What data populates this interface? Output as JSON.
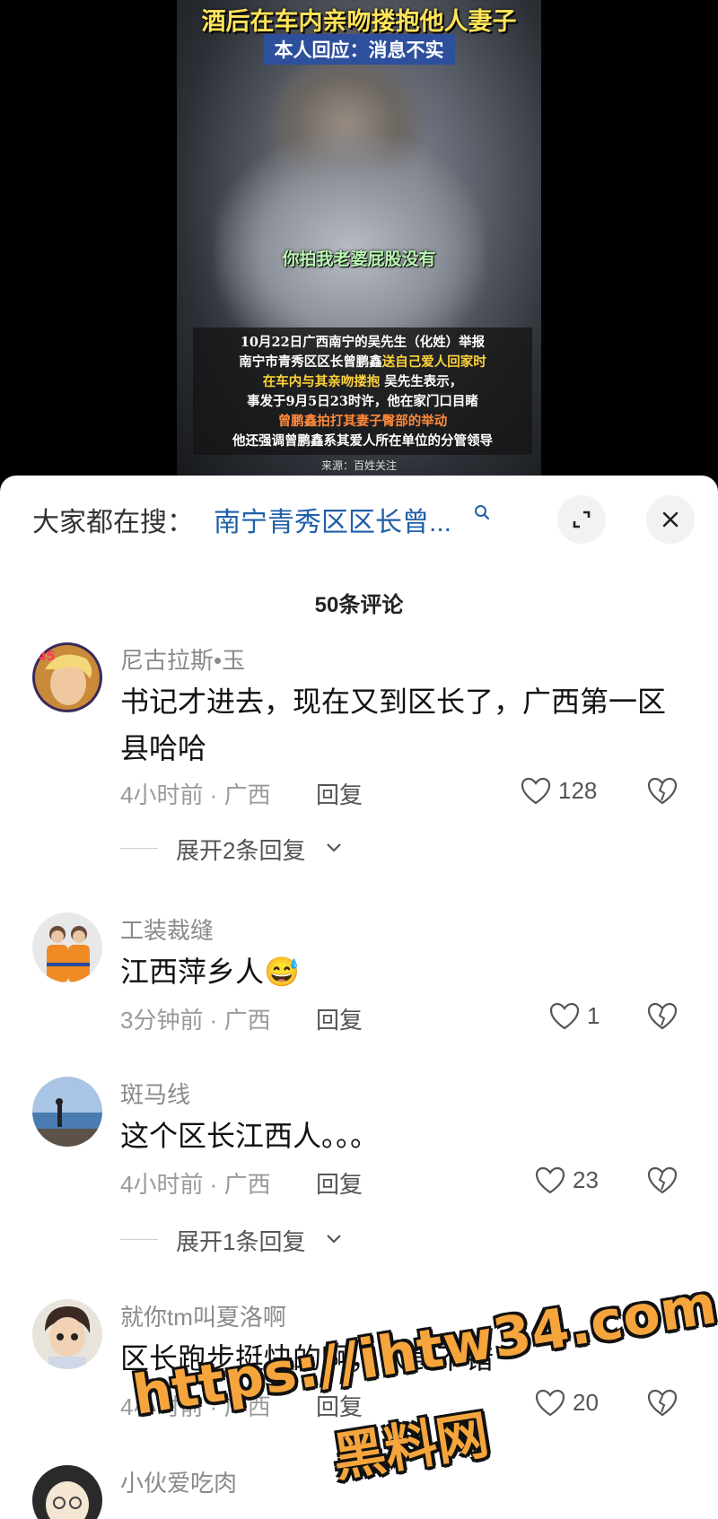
{
  "video": {
    "title": "酒后在车内亲吻搂抱他人妻子",
    "subtitle": "本人回应：消息不实",
    "caption": "你拍我老婆屁股没有",
    "text_lines": {
      "l1": "10月22日广西南宁的吴先生（化姓）举报",
      "l2a": "南宁市青秀区区长曾鹏鑫",
      "l2b": "送自己爱人回家时",
      "l3a": "在车内与其亲吻搂抱",
      "l3b": " 吴先生表示，",
      "l4": "事发于9月5日23时许，他在家门口目睹",
      "l5": "曾鹏鑫拍打其妻子臀部的举动",
      "l6": "他还强调曾鹏鑫系其爱人所在单位的分管领导"
    },
    "source": "来源：百姓关注"
  },
  "search": {
    "label": "大家都在搜：",
    "query": "南宁青秀区区长曾..."
  },
  "comments_header": "50条评论",
  "comments": [
    {
      "name": "尼古拉斯•玉",
      "text": "书记才进去，现在又到区长了，广西第一区县哈哈",
      "meta": "4小时前 · 广西",
      "reply": "回复",
      "likes": "128",
      "expand": "展开2条回复"
    },
    {
      "name": "工装裁缝",
      "text": "江西萍乡人",
      "emoji": "😅",
      "meta": "3分钟前 · 广西",
      "reply": "回复",
      "likes": "1"
    },
    {
      "name": "斑马线",
      "text": "这个区长江西人。。。",
      "meta": "4小时前 · 广西",
      "reply": "回复",
      "likes": "23",
      "expand": "展开1条回复"
    },
    {
      "name": "就你tm叫夏洛啊",
      "text": "区长跑步挺快的啊，伙食不错",
      "meta": "4小时前 · 广西",
      "reply": "回复",
      "likes": "20"
    },
    {
      "name": "小伙爱吃肉"
    }
  ],
  "watermark": {
    "url": "https://ihtw34.com",
    "name": "黑料网"
  },
  "colors": {
    "link": "#1f5fa8",
    "watermark": "#f5a53c",
    "title_yellow": "#ffe45a"
  }
}
